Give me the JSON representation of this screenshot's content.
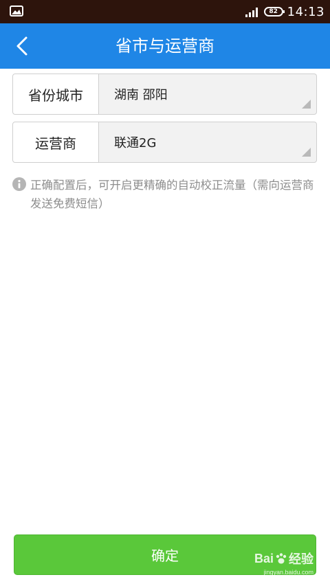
{
  "status_bar": {
    "left_icon": "image-icon",
    "signal_icon": "signal-icon",
    "battery_level": "82",
    "time": "14:13"
  },
  "header": {
    "back_icon": "chevron-left-icon",
    "title": "省市与运营商"
  },
  "form": {
    "region": {
      "label": "省份城市",
      "value": "湖南 邵阳"
    },
    "carrier": {
      "label": "运营商",
      "value": "联通2G"
    }
  },
  "info": {
    "icon": "info-icon",
    "text": "正确配置后，可开启更精确的自动校正流量（需向运营商发送免费短信）"
  },
  "confirm_label": "确定",
  "watermark": {
    "brand": "Bai",
    "brand_cn": "经验",
    "url": "jingyan.baidu.com"
  },
  "colors": {
    "status_bar": "#2d140c",
    "header": "#1f86e6",
    "button": "#5ac83a",
    "info_text": "#8d8d8d"
  }
}
